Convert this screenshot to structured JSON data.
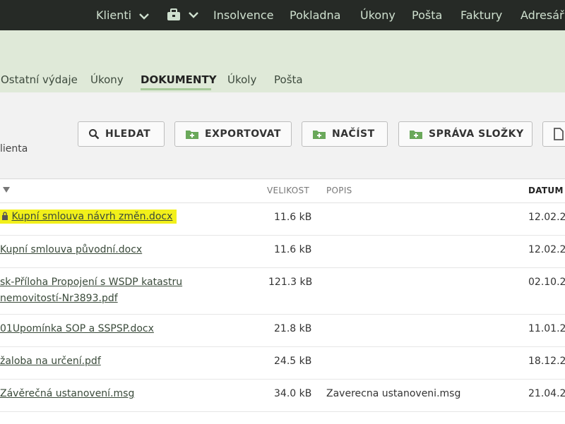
{
  "topnav": {
    "klienti": "Klienti",
    "insolvence": "Insolvence",
    "pokladna": "Pokladna",
    "ukony": "Úkony",
    "posta": "Pošta",
    "faktury": "Faktury",
    "adresar": "Adresář"
  },
  "tabs": [
    "Ostatní výdaje",
    "Úkony",
    "DOKUMENTY",
    "Úkoly",
    "Pošta"
  ],
  "toolbar": {
    "hledat": "HLEDAT",
    "exportovat": "EXPORTOVAT",
    "nacist": "NAČÍST",
    "sprava": "SPRÁVA SLOŽKY",
    "subtext": "lienta"
  },
  "table": {
    "col_size": "VELIKOST",
    "col_desc": "POPIS",
    "col_date": "DATUM",
    "rows": [
      {
        "name": "Kupní smlouva návrh změn.docx",
        "size": "11.6 kB",
        "desc": "",
        "date": "12.02.2"
      },
      {
        "name": "Kupní smlouva původní.docx",
        "size": "11.6 kB",
        "desc": "",
        "date": "12.02.2"
      },
      {
        "name": "sk-Příloha Propojení s WSDP katastru",
        "name2": "nemovitostí-Nr3893.pdf",
        "size": "121.3 kB",
        "desc": "",
        "date": "02.10.2"
      },
      {
        "name": "01Upomínka SOP a SSPSP.docx",
        "size": "21.8 kB",
        "desc": "",
        "date": "11.01.2"
      },
      {
        "name": "žaloba na určení.pdf",
        "size": "24.5 kB",
        "desc": "",
        "date": "18.12.2"
      },
      {
        "name": "Závěrečná ustanovení.msg",
        "size": "34.0 kB",
        "desc": "Zaverecna ustanoveni.msg",
        "date": "21.04.2"
      }
    ]
  },
  "colors": {
    "topbar": "#262a26",
    "band": "#dfe9d8",
    "highlight": "#f2f01a",
    "accent": "#6aa85a"
  }
}
